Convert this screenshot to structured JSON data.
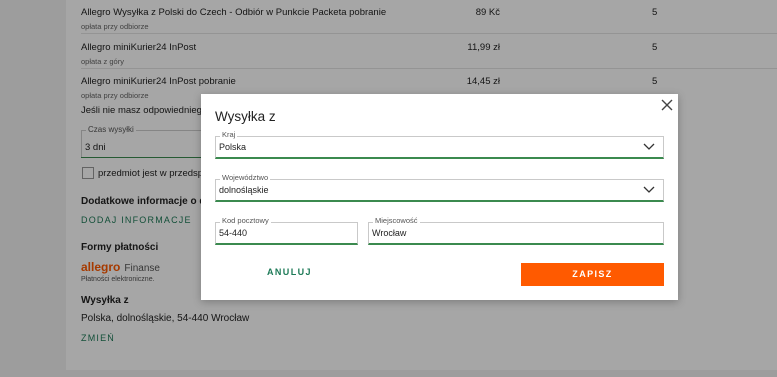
{
  "shipping_rows": [
    {
      "name": "Allegro Wysyłka z Polski do Czech - Odbiór w Punkcie Packeta pobranie",
      "sub": "opłata przy odbiorze",
      "price": "89 Kč",
      "qty": "5"
    },
    {
      "name": "Allegro miniKurier24 InPost",
      "sub": "opłata z góry",
      "price": "11,99 zł",
      "qty": "5"
    },
    {
      "name": "Allegro miniKurier24 InPost pobranie",
      "sub": "opłata przy odbiorze",
      "price": "14,45 zł",
      "qty": "5"
    }
  ],
  "note": "Jeśli nie masz odpowiedniego c",
  "delivery_time": {
    "label": "Czas wysyłki",
    "value": "3 dni"
  },
  "preorder_label": "przedmiot jest w przedspr...",
  "additional_info": {
    "heading": "Dodatkowe informacje o d",
    "link": "DODAJ INFORMACJE"
  },
  "payment": {
    "heading": "Formy płatności",
    "logo_brand": "allegro",
    "logo_product": "Finanse",
    "logo_sub": "Płatności elektroniczne."
  },
  "ship_from": {
    "heading": "Wysyłka z",
    "address": "Polska, dolnośląskie, 54-440 Wrocław",
    "link": "ZMIEŃ"
  },
  "modal": {
    "title": "Wysyłka z",
    "country": {
      "label": "Kraj",
      "value": "Polska"
    },
    "region": {
      "label": "Województwo",
      "value": "dolnośląskie"
    },
    "postal": {
      "label": "Kod pocztowy",
      "value": "54-440"
    },
    "city": {
      "label": "Miejscowość",
      "value": "Wrocław"
    },
    "cancel_label": "ANULUJ",
    "save_label": "ZAPISZ"
  },
  "colors": {
    "accent": "#ff5a00",
    "green": "#1d7a57",
    "field_underline": "#3b8a4f"
  }
}
